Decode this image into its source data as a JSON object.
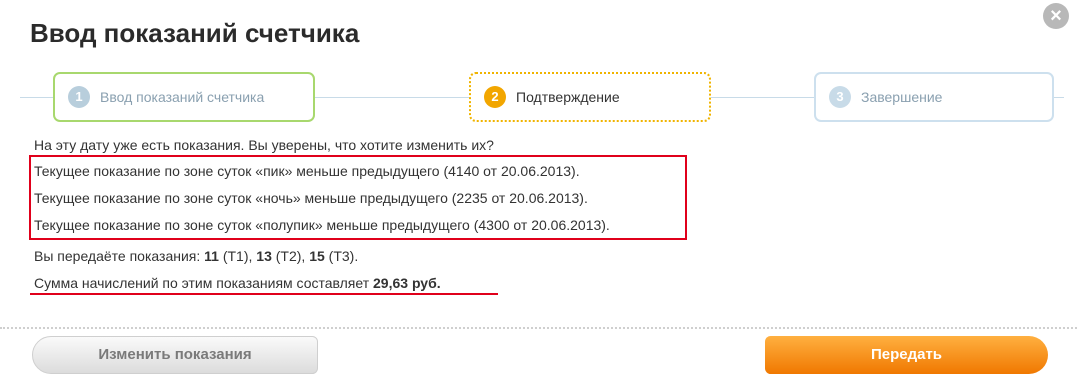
{
  "dialog": {
    "title": "Ввод показаний счетчика",
    "close_label": "×"
  },
  "steps": [
    {
      "number": "1",
      "label": "Ввод показаний счетчика",
      "state": "completed"
    },
    {
      "number": "2",
      "label": "Подтверждение",
      "state": "active"
    },
    {
      "number": "3",
      "label": "Завершение",
      "state": "pending"
    }
  ],
  "message": {
    "question": "На эту дату уже есть показания. Вы уверены, что хотите изменить их?",
    "warnings": [
      "Текущее показание по зоне суток «пик» меньше предыдущего (4140 от 20.06.2013).",
      "Текущее показание по зоне суток «ночь» меньше предыдущего (2235 от 20.06.2013).",
      "Текущее показание по зоне суток «полупик» меньше предыдущего (4300 от 20.06.2013)."
    ],
    "readings": {
      "prefix": "Вы передаёте показания: ",
      "t1_value": "11",
      "t1_label": " (Т1), ",
      "t2_value": "13",
      "t2_label": " (Т2), ",
      "t3_value": "15",
      "t3_label": " (Т3)."
    },
    "sum": {
      "prefix": "Сумма начислений по этим показаниям составляет ",
      "amount": "29,63 руб."
    }
  },
  "buttons": {
    "back_label": "Изменить показания",
    "submit_label": "Передать"
  },
  "colors": {
    "accent_orange": "#f07800",
    "highlight_red": "#e0001b",
    "step_done_border": "#a8d86e",
    "step_active_border": "#f0b400"
  }
}
